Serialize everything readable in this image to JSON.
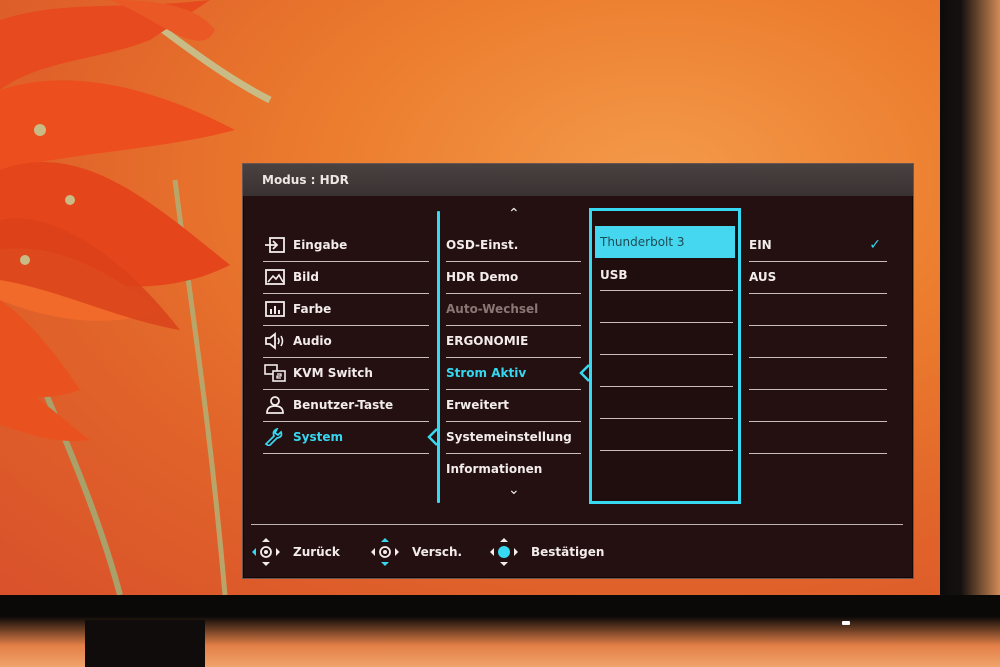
{
  "header": {
    "title": "Modus : HDR"
  },
  "main_menu": {
    "items": [
      {
        "label": "Eingabe",
        "icon": "input-icon"
      },
      {
        "label": "Bild",
        "icon": "image-icon"
      },
      {
        "label": "Farbe",
        "icon": "color-icon"
      },
      {
        "label": "Audio",
        "icon": "speaker-icon"
      },
      {
        "label": "KVM Switch",
        "icon": "kvm-switch-icon"
      },
      {
        "label": "Benutzer-Taste",
        "icon": "user-icon"
      },
      {
        "label": "System",
        "icon": "wrench-icon",
        "active": true
      }
    ]
  },
  "system_menu": {
    "items": [
      {
        "label": "OSD-Einst."
      },
      {
        "label": "HDR Demo"
      },
      {
        "label": "Auto-Wechsel",
        "disabled": true
      },
      {
        "label": "ERGONOMIE"
      },
      {
        "label": "Strom Aktiv",
        "active": true
      },
      {
        "label": "Erweitert"
      },
      {
        "label": "Systemeinstellung"
      },
      {
        "label": "Informationen"
      }
    ]
  },
  "strom_aktiv_options": {
    "selected": "Thunderbolt 3",
    "items": [
      "Thunderbolt 3",
      "USB"
    ]
  },
  "values": {
    "items": [
      "EIN",
      "AUS"
    ],
    "checked": "EIN"
  },
  "footer": {
    "back_label": "Zurück",
    "move_label": "Versch.",
    "confirm_label": "Bestätigen"
  },
  "colors": {
    "accent": "#37d8f1",
    "panel": "#251011",
    "header": "#3f3636",
    "text": "#f2ecea"
  }
}
